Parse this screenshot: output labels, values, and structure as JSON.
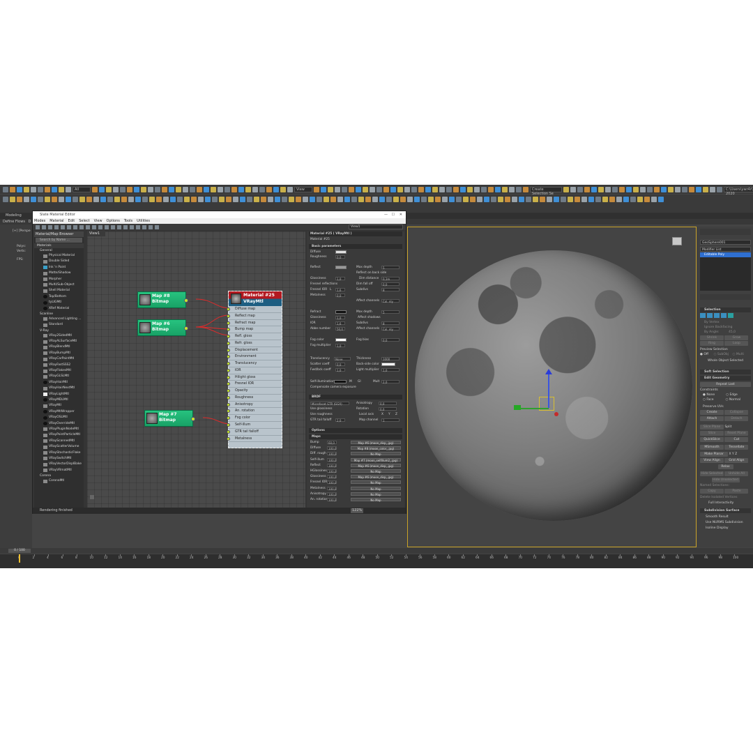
{
  "toolbar": {
    "all_filter": "All",
    "view_select": "View",
    "create_selection": "Create Selection Se",
    "path": "C:\\Users\\ywr4r\\Documents\\3ds Max 2020"
  },
  "ribbon": {
    "tab_modeling": "Modeling",
    "define_flows": "Define Flows",
    "row2_d": "D"
  },
  "viewport_left": {
    "label": "[+] [Perspe",
    "polys": "Polys:",
    "verts": "Verts:",
    "fps": "FPS:"
  },
  "slate": {
    "window_title": "Slate Material Editor",
    "menu": [
      "Modes",
      "Material",
      "Edit",
      "Select",
      "View",
      "Options",
      "Tools",
      "Utilities"
    ],
    "view_dropdown": "View1",
    "status": "Rendering finished",
    "zoom": "122%"
  },
  "browser": {
    "title": "Material/Map Browser",
    "search": "Search by Name ...",
    "materials_group": "Materials",
    "general_label": "General",
    "general_items": [
      "Physical Material",
      "Double Sided",
      "Ink 'n Paint",
      "Matte/Shadow",
      "Morpher",
      "Multi/Sub-Object",
      "Shell Material",
      "Top/Bottom",
      "tyLIGMtl",
      "XRef Material"
    ],
    "scanline_label": "Scanline",
    "scanline_items": [
      "Advanced Lighting ...",
      "Standard"
    ],
    "vray_label": "V-Ray",
    "vray_items": [
      "VRay2SidedMtl",
      "VRayALSurfaceMtl",
      "VRayBlendMtl",
      "VRayBumpMtl",
      "VRayCarPaintMtl",
      "VRayFastSSS2",
      "VRayFlakesMtl",
      "VRayGLSLMtl",
      "VRayHairMtl",
      "VRayHairNextMtl",
      "VRayLightMtl",
      "VRayMDLMtl",
      "VRayMtl",
      "VRayMtlWrapper",
      "VRayOSLMtl",
      "VRayOverrideMtl",
      "VRayPluginNodeMtl",
      "VRayPointParticleMtl",
      "VRayScannedMtl",
      "VRayScatterVolume",
      "VRayStochasticFlake",
      "VRaySwitchMtl",
      "VRayVectorDisplBake",
      "VRayVRmatMtl"
    ],
    "corona_label": "Corona",
    "corona_items": [
      "CoronaMtl"
    ]
  },
  "nodes": {
    "view_tab": "View1",
    "map8": {
      "name": "Map #8",
      "type": "Bitmap"
    },
    "map6": {
      "name": "Map #6",
      "type": "Bitmap"
    },
    "map7": {
      "name": "Map #7",
      "type": "Bitmap"
    },
    "material": {
      "name": "Material #25",
      "type": "VRayMtl"
    },
    "slots": [
      "Diffuse map",
      "Reflect map",
      "Refract map",
      "Bump map",
      "Refl. gloss",
      "Refr. gloss",
      "Displacement",
      "Environment",
      "Translucency",
      "IOR",
      "Hilight gloss",
      "Fresnel IOR",
      "Opacity",
      "Roughness",
      "Anisotropy",
      "An. rotation",
      "Fog color",
      "Self-illum",
      "GTR tail falloff",
      "Metalness"
    ]
  },
  "props": {
    "header": "Material #25  ( VRayMtl )",
    "name": "Material #25",
    "basic": "Basic parameters",
    "diffuse": "Diffuse",
    "roughness": "Roughness",
    "roughness_v": "0,0",
    "reflect": "Reflect",
    "max_depth": "Max depth",
    "max_depth_v": "5",
    "reflect_backside": "Reflect on back side",
    "glossiness": "Glossiness",
    "gloss_v": "1,0",
    "dim_distance": "Dim distance",
    "dim_distance_v": "0,1m",
    "fresnel_reflections": "Fresnel reflections",
    "dim_falloff": "Dim fall off",
    "dim_falloff_v": "0,0",
    "fresnel_ior": "Fresnel IOR",
    "fresnel_ior_l": "L",
    "fresnel_ior_v": "1,6",
    "subdivs": "Subdivs",
    "subdivs_v": "8",
    "metalness": "Metalness",
    "metalness_v": "0,0",
    "affect_channels": "Affect channels",
    "affect_channels_v": "Col. nly",
    "refract": "Refract",
    "refr_max_depth_v": "5",
    "affect_shadows": "Affect shadows",
    "refr_gloss_v": "1,0",
    "ior": "IOR",
    "ior_v": "1,6",
    "refr_subdivs_v": "8",
    "abbe_number": "Abbe number",
    "abbe_v": "50,0",
    "refr_affect_v": "Col. nly",
    "fog_color": "Fog color",
    "fog_bias": "Fog bias",
    "fog_bias_v": "0,0",
    "fog_multiplier": "Fog multiplier",
    "fog_mult_v": "1,0",
    "translucency": "Translucency",
    "translucency_v": "None",
    "thickness": "Thickness",
    "thickness_v": "1000",
    "scatter_coeff": "Scatter coeff",
    "scatter_v": "0,0",
    "back_side_color": "Back-side color",
    "fwd_bck_coeff": "Fwd/bck coeff",
    "fwd_v": "1,0",
    "light_multiplier": "Light multiplier",
    "light_mult_v": "1,0",
    "self_illumination": "Self-illumination",
    "self_m": "M",
    "self_gi": "GI",
    "mult": "Mult",
    "mult_v": "2,0",
    "compensate": "Compensate camera exposure",
    "brdf": "BRDF",
    "brdf_type": "Microfacet GTR (GGX)",
    "anisotropy": "Anisotropy",
    "anisotropy_v": "0,0",
    "use_glossiness": "Use glossiness",
    "rotation": "Rotation",
    "rotation_v": "0,0",
    "use_roughness": "Use roughness",
    "local_axis": "Local axis",
    "axis_x": "X",
    "axis_y": "Y",
    "axis_z": "Z",
    "gtr_tail_falloff": "GTR tail falloff",
    "gtr_v": "2,0",
    "map_channel": "Map channel",
    "map_channel_v": "1",
    "options": "Options",
    "maps": "Maps",
    "map_rows": [
      {
        "label": "Bump",
        "amount": "60,0",
        "map": "Map #6 (moon_disp_.jpg)"
      },
      {
        "label": "Diffuse",
        "amount": "100,0",
        "map": "Map #8 (moon_color_.jpg)"
      },
      {
        "label": "Diff. rough",
        "amount": "100,0",
        "map": "No Map"
      },
      {
        "label": "Self-illum",
        "amount": "100,0",
        "map": "Map #7 (moon_selfillum2_.jpg)"
      },
      {
        "label": "Reflect",
        "amount": "100,0",
        "map": "Map #6 (moon_disp_.jpg)"
      },
      {
        "label": "HGlossiness",
        "amount": "100,0",
        "map": "No Map"
      },
      {
        "label": "Glossiness",
        "amount": "100,0",
        "map": "Map #6 (moon_disp_.jpg)"
      },
      {
        "label": "Fresnel IOR",
        "amount": "100,0",
        "map": "No Map"
      },
      {
        "label": "Metalness",
        "amount": "100,0",
        "map": "No Map"
      },
      {
        "label": "Anisotropy",
        "amount": "100,0",
        "map": "No Map"
      },
      {
        "label": "An. rotation",
        "amount": "100,0",
        "map": "No Map"
      }
    ]
  },
  "cmd": {
    "object_name": "GeoSphere001",
    "modifier_list": "Modifier List",
    "stack_item": "Editable Poly",
    "selection": "Selection",
    "by_vertex": "By Vertex",
    "ignore_backfacing": "Ignore Backfacing",
    "by_angle": "By Angle:",
    "by_angle_v": "45,0",
    "shrink": "Shrink",
    "grow": "Grow",
    "ring": "Ring",
    "loop": "Loop",
    "preview_selection": "Preview Selection",
    "off": "Off",
    "subobj": "SubObj",
    "multi": "Multi",
    "whole_object": "Whole Object Selected",
    "soft_selection": "Soft Selection",
    "edit_geometry": "Edit Geometry",
    "repeat_last": "Repeat Last",
    "constraints": "Constraints",
    "none": "None",
    "edge": "Edge",
    "face": "Face",
    "normal": "Normal",
    "preserve_uvs": "Preserve UVs",
    "create": "Create",
    "collapse": "Collapse",
    "attach": "Attach",
    "detach": "Detach",
    "slice_plane": "Slice Plane",
    "split": "Split",
    "slice": "Slice",
    "reset_plane": "Reset Plane",
    "quickslice": "QuickSlice",
    "cut": "Cut",
    "msmooth": "MSmooth",
    "tessellate": "Tessellate",
    "make_planar": "Make Planar",
    "px": "X",
    "py": "Y",
    "pz": "Z",
    "view_align": "View Align",
    "grid_align": "Grid Align",
    "relax": "Relax",
    "hide_selected": "Hide Selected",
    "unhide_all": "Unhide All",
    "hide_unselected": "Hide Unselected",
    "named_selections": "Named Selections:",
    "copy": "Copy",
    "paste": "Paste",
    "delete_isolated": "Delete Isolated Vertices",
    "full_interactivity": "Full Interactivity",
    "subdivision_surface": "Subdivision Surface",
    "smooth_result": "Smooth Result",
    "use_nurms": "Use NURMS Subdivision",
    "isoline_display": "Isoline Display"
  },
  "timeline": {
    "frame": "0 / 100",
    "ticks": [
      "0",
      "2",
      "4",
      "6",
      "8",
      "10",
      "12",
      "14",
      "16",
      "18",
      "20",
      "22",
      "24",
      "26",
      "28",
      "30",
      "32",
      "34",
      "36",
      "38",
      "40",
      "42",
      "44",
      "46",
      "48",
      "50",
      "52",
      "54",
      "56",
      "58",
      "60",
      "62",
      "64",
      "66",
      "68",
      "70",
      "72",
      "74",
      "76",
      "78",
      "80",
      "82",
      "84",
      "86",
      "88",
      "90",
      "92",
      "94",
      "96",
      "98",
      "100"
    ]
  },
  "colors": {
    "map_node": "#1fb574",
    "material_head_red": "#b31920",
    "material_head_blue": "#1d5e82",
    "wire": "#e02a2a",
    "slot_dot": "#c8e82a"
  }
}
